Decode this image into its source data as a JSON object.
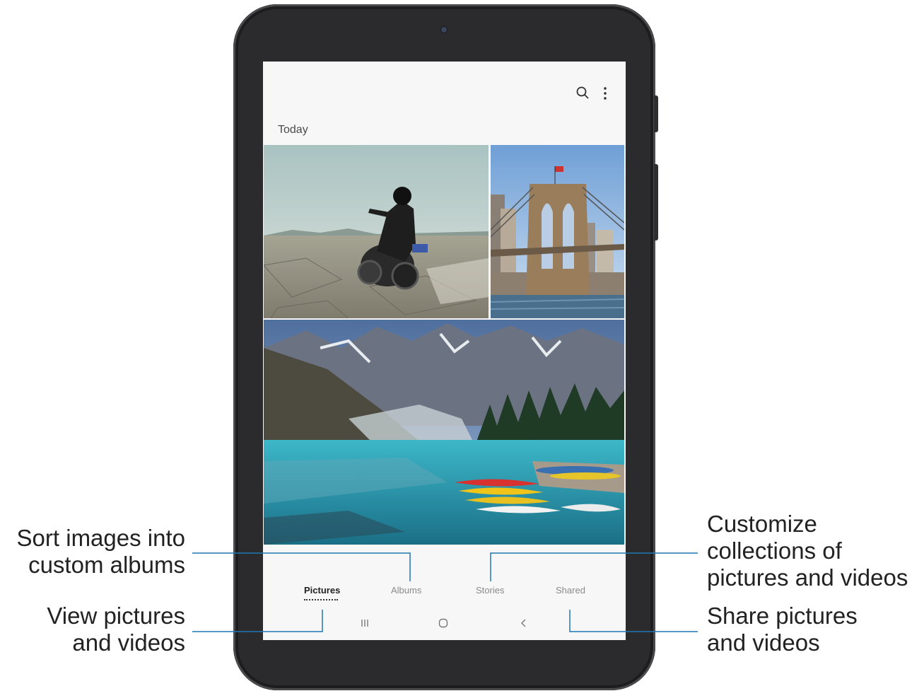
{
  "gallery": {
    "section_title": "Today",
    "tabs": [
      {
        "label": "Pictures",
        "active": true
      },
      {
        "label": "Albums",
        "active": false
      },
      {
        "label": "Stories",
        "active": false
      },
      {
        "label": "Shared",
        "active": false
      }
    ]
  },
  "icons": {
    "top_actions": [
      "search-icon",
      "more-options-icon"
    ],
    "nav_bar": [
      "recent-apps-icon",
      "home-icon",
      "back-icon"
    ]
  },
  "callouts": {
    "albums": [
      "Sort images into",
      "custom albums"
    ],
    "pictures": [
      "View pictures",
      "and videos"
    ],
    "stories": [
      "Customize",
      "collections of",
      "pictures and videos"
    ],
    "shared": [
      "Share pictures",
      "and videos"
    ]
  },
  "colors": {
    "callout_line": "#1f77b4",
    "device_body": "#2b2b2d",
    "screen_bg": "#f7f7f7"
  }
}
